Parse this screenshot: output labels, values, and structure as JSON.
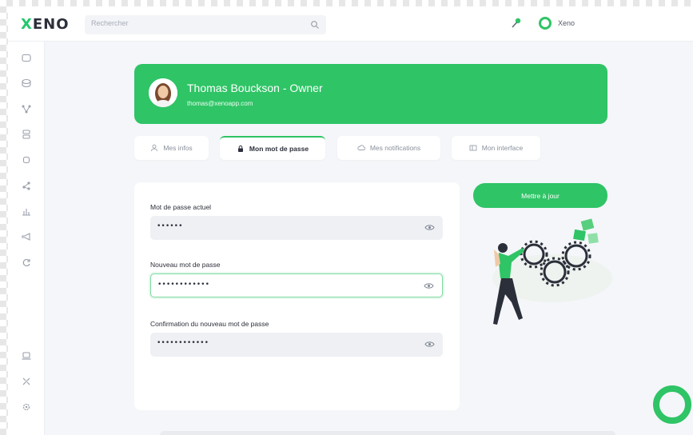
{
  "app": {
    "logo_text_accent": "X",
    "logo_text": "ENO",
    "brand_color": "#2fc466"
  },
  "search": {
    "placeholder": "Rechercher",
    "icon": "search-icon"
  },
  "header": {
    "user_label": "Xeno",
    "pin_icon": "pin-icon"
  },
  "sidebar": {
    "items": [
      {
        "icon": "chat-icon"
      },
      {
        "icon": "box-icon"
      },
      {
        "icon": "network-icon"
      },
      {
        "icon": "database-icon"
      },
      {
        "icon": "settings-gear-icon"
      },
      {
        "icon": "share-icon"
      },
      {
        "icon": "chart-icon"
      },
      {
        "icon": "megaphone-icon"
      },
      {
        "icon": "refresh-icon"
      },
      {
        "icon": "laptop-icon"
      },
      {
        "icon": "tools-icon"
      },
      {
        "icon": "gear-icon"
      }
    ]
  },
  "profile": {
    "name": "Thomas Bouckson - Owner",
    "email": "thomas@xenoapp.com"
  },
  "tabs": [
    {
      "label": "Mes infos",
      "icon": "user-icon",
      "active": false
    },
    {
      "label": "Mon mot de passe",
      "icon": "lock-icon",
      "active": true
    },
    {
      "label": "Mes notifications",
      "icon": "cloud-icon",
      "active": false
    },
    {
      "label": "Mon interface",
      "icon": "layout-icon",
      "active": false
    }
  ],
  "form": {
    "current_label": "Mot de passe actuel",
    "current_value": "••••••",
    "new_label": "Nouveau mot de passe",
    "new_value": "••••••••••••",
    "confirm_label": "Confirmation du nouveau mot de passe",
    "confirm_value": "••••••••••••"
  },
  "actions": {
    "update_label": "Mettre à jour"
  }
}
